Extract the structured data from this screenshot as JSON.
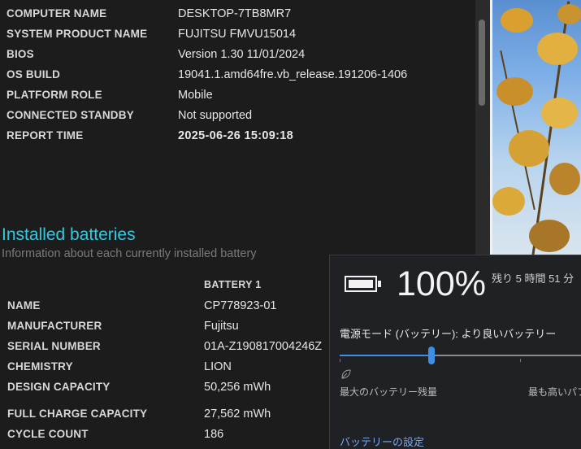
{
  "system_info": [
    {
      "key": "COMPUTER NAME",
      "value": "DESKTOP-7TB8MR7"
    },
    {
      "key": "SYSTEM PRODUCT NAME",
      "value": "FUJITSU FMVU15014"
    },
    {
      "key": "BIOS",
      "value": "Version 1.30 11/01/2024"
    },
    {
      "key": "OS BUILD",
      "value": "19041.1.amd64fre.vb_release.191206-1406"
    },
    {
      "key": "PLATFORM ROLE",
      "value": "Mobile"
    },
    {
      "key": "CONNECTED STANDBY",
      "value": "Not supported"
    },
    {
      "key": "REPORT TIME",
      "value": "2025-06-26  15:09:18"
    }
  ],
  "installed_batteries": {
    "title": "Installed batteries",
    "subtitle": "Information about each currently installed battery",
    "column_header": "BATTERY 1",
    "rows": [
      {
        "key": "NAME",
        "value": "CP778923-01"
      },
      {
        "key": "MANUFACTURER",
        "value": "Fujitsu"
      },
      {
        "key": "SERIAL NUMBER",
        "value": "01A-Z190817004246Z"
      },
      {
        "key": "CHEMISTRY",
        "value": "LION"
      },
      {
        "key": "DESIGN CAPACITY",
        "value": "50,256 mWh"
      },
      {
        "key": "FULL CHARGE CAPACITY",
        "value": "27,562 mWh"
      },
      {
        "key": "CYCLE COUNT",
        "value": "186"
      }
    ]
  },
  "battery_flyout": {
    "percent": "100%",
    "remaining": "残り 5 時間 51 分",
    "power_mode_label": "電源モード (バッテリー): より良いバッテリー",
    "slider_level": 0.38,
    "left_label": "最大のバッテリー残量",
    "right_label": "最も高いパフォ",
    "settings_link": "バッテリーの設定"
  },
  "colors": {
    "section_title": "#35c8e0",
    "accent": "#3d8fe6",
    "link": "#78a8f0"
  }
}
